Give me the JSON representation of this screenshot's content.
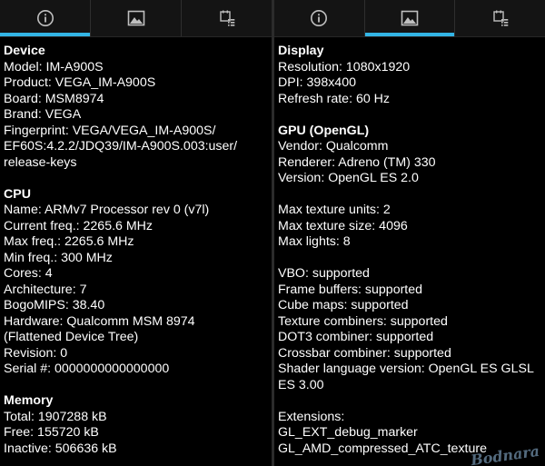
{
  "left": {
    "tabs": [
      {
        "icon": "info-icon",
        "active": true
      },
      {
        "icon": "image-icon",
        "active": false
      },
      {
        "icon": "list-icon",
        "active": false
      }
    ],
    "device": {
      "title": "Device",
      "rows": [
        "Model: IM-A900S",
        "Product: VEGA_IM-A900S",
        "Board: MSM8974",
        "Brand: VEGA",
        "Fingerprint: VEGA/VEGA_IM-A900S/",
        "EF60S:4.2.2/JDQ39/IM-A900S.003:user/",
        "release-keys"
      ]
    },
    "cpu": {
      "title": "CPU",
      "rows": [
        "Name: ARMv7 Processor rev 0 (v7l)",
        "Current freq.: 2265.6 MHz",
        "Max freq.: 2265.6 MHz",
        "Min freq.: 300 MHz",
        "Cores: 4",
        "Architecture: 7",
        "BogoMIPS: 38.40",
        "Hardware: Qualcomm MSM 8974",
        "(Flattened Device Tree)",
        "Revision: 0",
        "Serial #: 0000000000000000"
      ]
    },
    "memory": {
      "title": "Memory",
      "rows": [
        "Total: 1907288 kB",
        "Free: 155720 kB",
        "Inactive: 506636 kB"
      ]
    }
  },
  "right": {
    "tabs": [
      {
        "icon": "info-icon",
        "active": false
      },
      {
        "icon": "image-icon",
        "active": true
      },
      {
        "icon": "list-icon",
        "active": false
      }
    ],
    "display": {
      "title": "Display",
      "rows": [
        "Resolution: 1080x1920",
        "DPI: 398x400",
        "Refresh rate: 60 Hz"
      ]
    },
    "gpu": {
      "title": "GPU (OpenGL)",
      "rows": [
        "Vendor: Qualcomm",
        "Renderer: Adreno (TM) 330",
        "Version: OpenGL ES 2.0"
      ]
    },
    "limits": {
      "rows": [
        "Max texture units: 2",
        "Max texture size: 4096",
        "Max lights: 8"
      ]
    },
    "features": {
      "rows": [
        "VBO: supported",
        "Frame buffers: supported",
        "Cube maps: supported",
        "Texture combiners: supported",
        "DOT3 combiner: supported",
        "Crossbar combiner: supported",
        "Shader language version: OpenGL ES GLSL",
        "ES 3.00"
      ]
    },
    "extensions": {
      "rows": [
        "Extensions:",
        "GL_EXT_debug_marker",
        "GL_AMD_compressed_ATC_texture"
      ]
    }
  },
  "watermark": "Bodnara",
  "colors": {
    "accent": "#33b5e5",
    "icon": "#bfbfbf",
    "background": "#000000",
    "tabbar": "#141414"
  }
}
